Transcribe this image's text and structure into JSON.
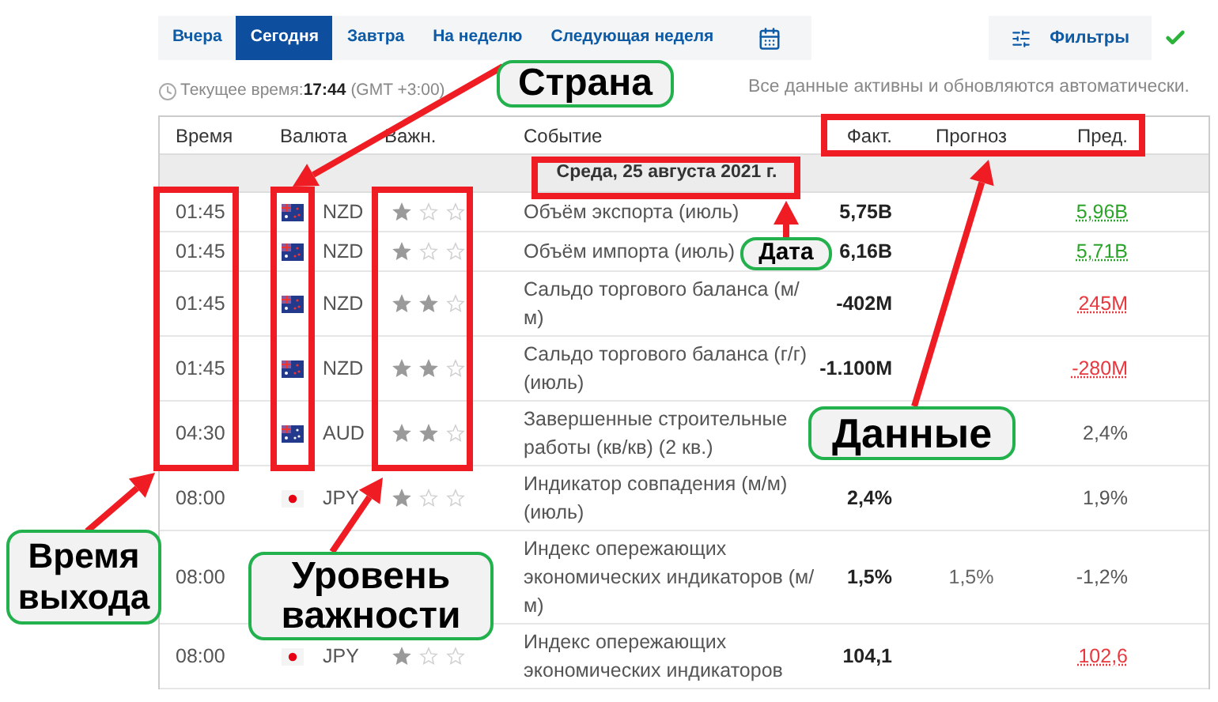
{
  "tabs": [
    {
      "label": "Вчера",
      "selected": false
    },
    {
      "label": "Сегодня",
      "selected": true
    },
    {
      "label": "Завтра",
      "selected": false
    },
    {
      "label": "На неделю",
      "selected": false
    },
    {
      "label": "Следующая неделя",
      "selected": false
    },
    {
      "kind": "calendar",
      "selected": false
    }
  ],
  "filters_button": {
    "label": "Фильтры"
  },
  "clock": {
    "label": "Текущее время:",
    "time": "17:44",
    "timezone": "(GMT +3:00)"
  },
  "auto_update_note": "Все данные активны и обновляются автоматически.",
  "table": {
    "columns": [
      "Время",
      "Валюта",
      "Важн.",
      "Событие",
      "Факт.",
      "Прогноз",
      "Пред."
    ],
    "date": "Среда, 25 августа 2021 г.",
    "rows": [
      {
        "time": "01:45",
        "kind": "nz",
        "currency": "NZD",
        "stars": 1,
        "event": "Объём экспорта (июль)",
        "actual": "5,75B",
        "previous": "5,96B",
        "color": "#2aa52a"
      },
      {
        "time": "01:45",
        "kind": "nz",
        "currency": "NZD",
        "stars": 1,
        "event": "Объём импорта (июль)",
        "actual": "6,16B",
        "previous": "5,71B",
        "color": "#2aa52a"
      },
      {
        "time": "01:45",
        "kind": "nz",
        "currency": "NZD",
        "stars": 2,
        "event": "Сальдо торгового баланса (м/м)",
        "actual": "-402M",
        "previous": "245M",
        "color": "#e8373d"
      },
      {
        "time": "01:45",
        "kind": "nz",
        "currency": "NZD",
        "stars": 2,
        "event": "Сальдо торгового баланса (г/г) (июль)",
        "actual": "-1.100M",
        "previous": "-280M",
        "color": "#e8373d"
      },
      {
        "time": "04:30",
        "kind": "au",
        "currency": "AUD",
        "stars": 2,
        "event": "Завершенные строительные работы (кв/кв) (2 кв.)",
        "previous": "2,4%"
      },
      {
        "time": "08:00",
        "kind": "jp",
        "currency": "JPY",
        "stars": 1,
        "event": "Индикатор совпадения (м/м) (июль)",
        "actual": "2,4%",
        "previous": "1,9%"
      },
      {
        "time": "08:00",
        "event": "Индекс опережающих экономических индикаторов (м/м)",
        "actual": "1,5%",
        "forecast": "1,5%",
        "previous": "-1,2%"
      },
      {
        "time": "08:00",
        "kind": "jp",
        "currency": "JPY",
        "stars": 1,
        "event": "Индекс опережающих экономических индикаторов",
        "actual": "104,1",
        "previous": "102,6",
        "color": "#e8373d"
      }
    ]
  },
  "annotations": [
    {
      "label": "Страна"
    },
    {
      "label": "Дата"
    },
    {
      "label": "Данные"
    },
    {
      "label": "Время выхода"
    },
    {
      "label": "Уровень важности"
    }
  ]
}
